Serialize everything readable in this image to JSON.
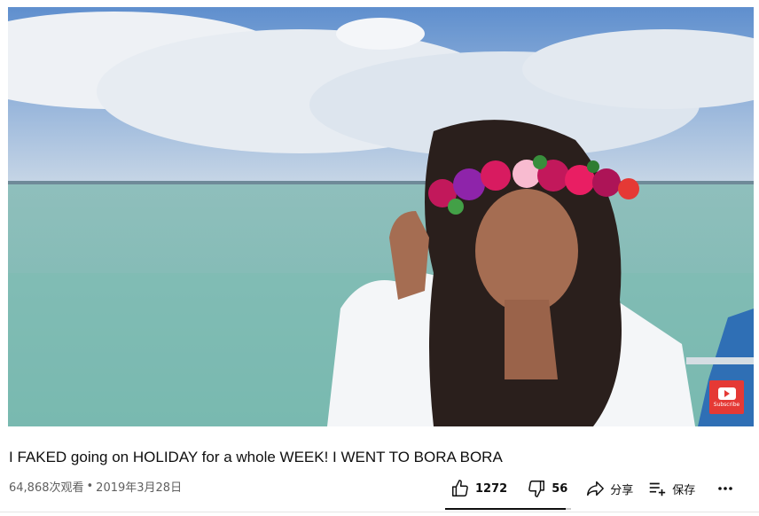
{
  "video": {
    "title": "I FAKED going on HOLIDAY for a whole WEEK! I WENT TO BORA BORA",
    "views": "64,868次观看",
    "separator": "•",
    "date": "2019年3月28日",
    "watermark_text": "Subscribe"
  },
  "actions": {
    "like_count": "1272",
    "dislike_count": "56",
    "share_label": "分享",
    "save_label": "保存"
  },
  "sentiment": {
    "like_fraction": 0.958
  },
  "colors": {
    "watermark": "#e53935",
    "text": "#0f0f0f",
    "meta": "#606060"
  },
  "icons": [
    "thumbs-up-icon",
    "thumbs-down-icon",
    "share-icon",
    "save-playlist-icon",
    "more-icon",
    "youtube-logo-icon"
  ]
}
